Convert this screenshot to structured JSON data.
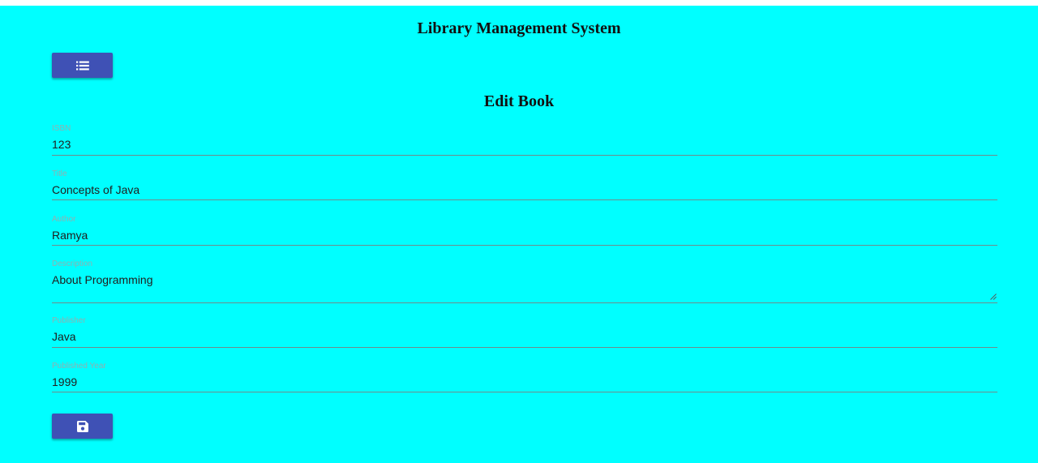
{
  "header": {
    "title": "Library Management System"
  },
  "toolbar": {
    "list_button_icon": "list-icon"
  },
  "form": {
    "heading": "Edit Book",
    "fields": [
      {
        "label": "ISBN",
        "value": "123"
      },
      {
        "label": "Title",
        "value": "Concepts of Java"
      },
      {
        "label": "Author",
        "value": "Ramya"
      },
      {
        "label": "Description",
        "value": "About Programming"
      },
      {
        "label": "Publisher",
        "value": "Java"
      },
      {
        "label": "Published Year",
        "value": "1999"
      }
    ],
    "save_button_icon": "save-icon"
  },
  "colors": {
    "background": "#00ffff",
    "button": "#3f51b5"
  }
}
